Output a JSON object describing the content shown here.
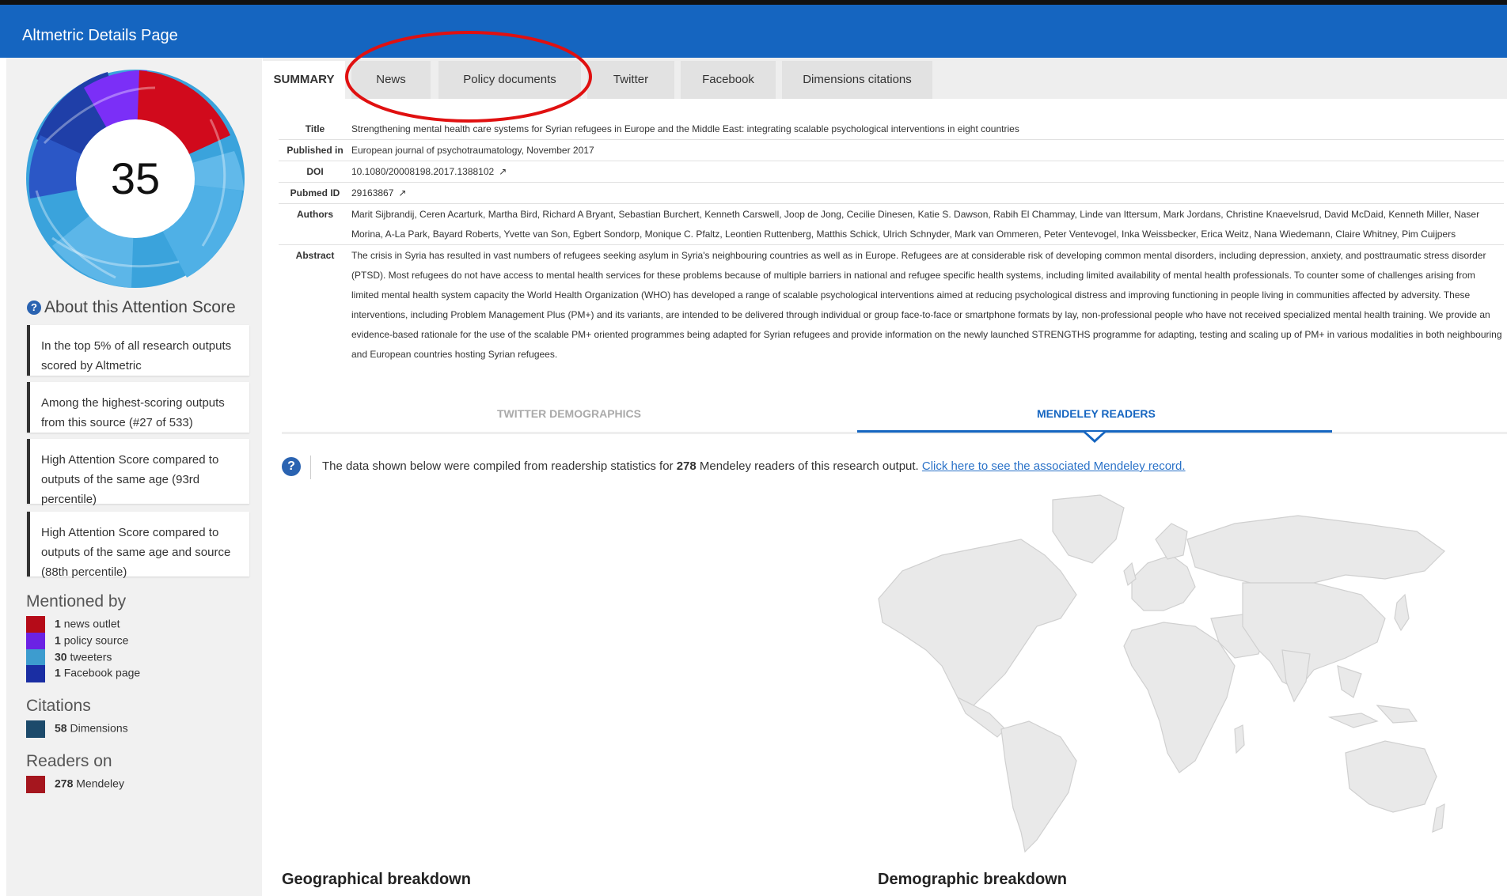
{
  "app": {
    "title": "Altmetric Details Page"
  },
  "score": {
    "value": "35",
    "donut_colors": {
      "news": "#c9081f",
      "policy": "#7b2ff7",
      "twitter": "#3fa4df",
      "facebook": "#1f3fa8"
    }
  },
  "about": {
    "title": "About this Attention Score",
    "items": [
      "In the top 5% of all research outputs scored by Altmetric",
      "Among the highest-scoring outputs from this source (#27 of 533)",
      "High Attention Score compared to outputs of the same age (93rd percentile)",
      "High Attention Score compared to outputs of the same age and source (88th percentile)"
    ]
  },
  "mentioned_by": {
    "title": "Mentioned by",
    "items": [
      {
        "count": "1",
        "label": "news outlet",
        "color": "#b50b18"
      },
      {
        "count": "1",
        "label": "policy source",
        "color": "#6b22e4"
      },
      {
        "count": "30",
        "label": "tweeters",
        "color": "#3d9ccf"
      },
      {
        "count": "1",
        "label": "Facebook page",
        "color": "#1a2ea3"
      }
    ]
  },
  "citations": {
    "title": "Citations",
    "items": [
      {
        "count": "58",
        "label": "Dimensions",
        "color": "#1c4a6b"
      }
    ]
  },
  "readers": {
    "title": "Readers on",
    "items": [
      {
        "count": "278",
        "label": "Mendeley",
        "color": "#a5161e"
      }
    ]
  },
  "tabs": [
    {
      "label": "SUMMARY",
      "active": true
    },
    {
      "label": "News"
    },
    {
      "label": "Policy documents"
    },
    {
      "label": "Twitter"
    },
    {
      "label": "Facebook"
    },
    {
      "label": "Dimensions citations"
    }
  ],
  "details": {
    "title_label": "Title",
    "title": "Strengthening mental health care systems for Syrian refugees in Europe and the Middle East: integrating scalable psychological interventions in eight countries",
    "published_label": "Published in",
    "published": "European journal of psychotraumatology, November 2017",
    "doi_label": "DOI",
    "doi": "10.1080/20008198.2017.1388102",
    "pubmed_label": "Pubmed ID",
    "pubmed": "29163867",
    "authors_label": "Authors",
    "authors": "Marit Sijbrandij, Ceren Acarturk, Martha Bird, Richard A Bryant, Sebastian Burchert, Kenneth Carswell, Joop de Jong, Cecilie Dinesen, Katie S. Dawson, Rabih El Chammay, Linde van Ittersum, Mark Jordans, Christine Knaevelsrud, David McDaid, Kenneth Miller, Naser Morina, A-La Park, Bayard Roberts, Yvette van Son, Egbert Sondorp, Monique C. Pfaltz, Leontien Ruttenberg, Matthis Schick, Ulrich Schnyder, Mark van Ommeren, Peter Ventevogel, Inka Weissbecker, Erica Weitz, Nana Wiedemann, Claire Whitney, Pim Cuijpers",
    "abstract_label": "Abstract",
    "abstract": "The crisis in Syria has resulted in vast numbers of refugees seeking asylum in Syria's neighbouring countries as well as in Europe. Refugees are at considerable risk of developing common mental disorders, including depression, anxiety, and posttraumatic stress disorder (PTSD). Most refugees do not have access to mental health services for these problems because of multiple barriers in national and refugee specific health systems, including limited availability of mental health professionals. To counter some of challenges arising from limited mental health system capacity the World Health Organization (WHO) has developed a range of scalable psychological interventions aimed at reducing psychological distress and improving functioning in people living in communities affected by adversity. These interventions, including Problem Management Plus (PM+) and its variants, are intended to be delivered through individual or group face-to-face or smartphone formats by lay, non-professional people who have not received specialized mental health training. We provide an evidence-based rationale for the use of the scalable PM+ oriented programmes being adapted for Syrian refugees and provide information on the newly launched STRENGTHS programme for adapting, testing and scaling up of PM+ in various modalities in both neighbouring and European countries hosting Syrian refugees."
  },
  "subtabs": [
    {
      "label": "TWITTER DEMOGRAPHICS",
      "active": false
    },
    {
      "label": "MENDELEY READERS",
      "active": true
    }
  ],
  "info": {
    "text_before": "The data shown below were compiled from readership statistics for ",
    "count": "278",
    "text_after": " Mendeley readers of this research output. ",
    "link": "Click here to see the associated Mendeley record."
  },
  "sections": {
    "geo": "Geographical breakdown",
    "demo": "Demographic breakdown"
  },
  "annotation_color": "#e01010"
}
